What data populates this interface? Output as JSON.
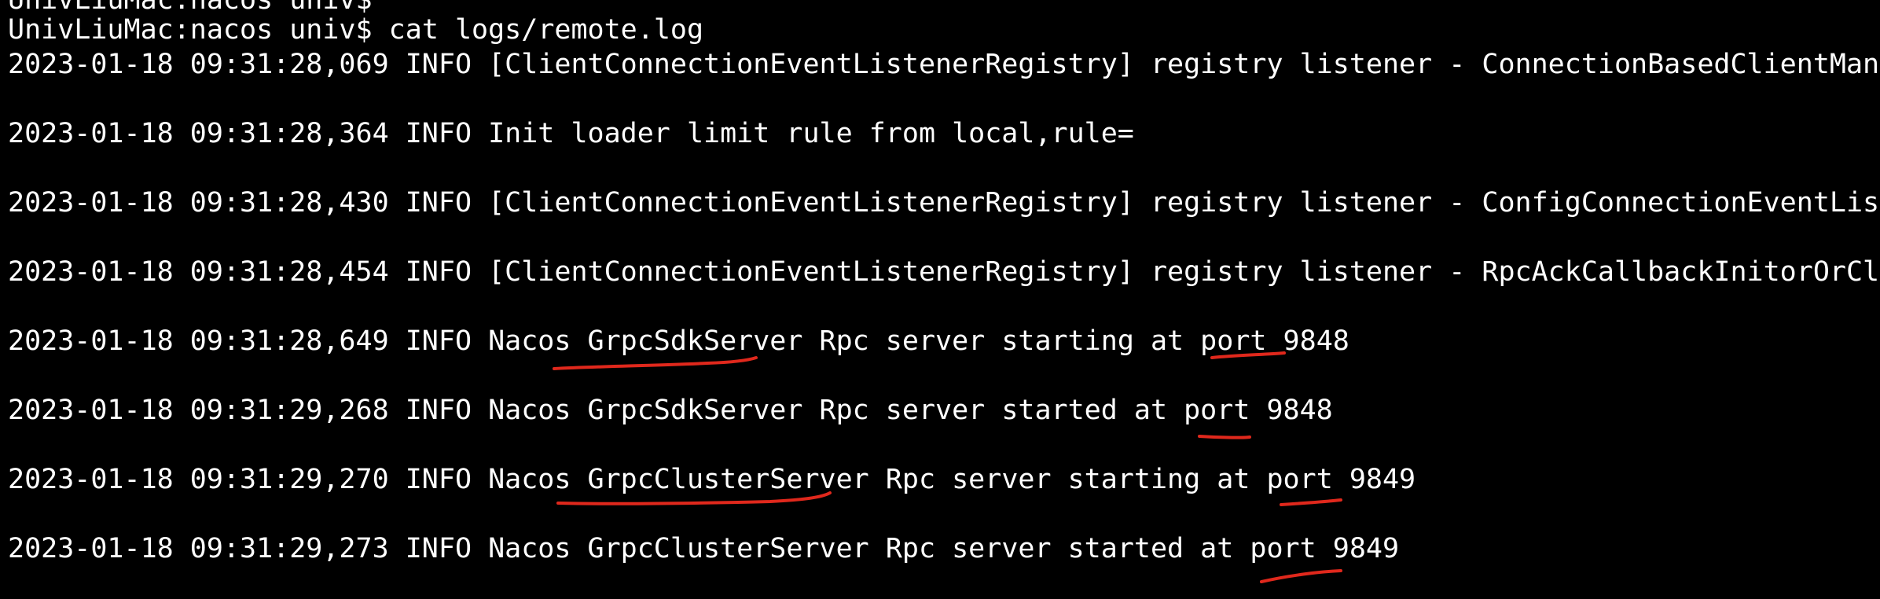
{
  "terminal": {
    "background": "#000000",
    "foreground": "#ffffff",
    "annotation_color": "#e0281c",
    "prev_prompt": "UnivLiuMac:nacos univ$",
    "prompt": "UnivLiuMac:nacos univ$",
    "command": "cat logs/remote.log",
    "log": [
      {
        "prefix": "2023-01-18 09:31:28,069 INFO [ClientConnectionEventListenerRegistry] registry listener - ConnectionBasedClientManager"
      },
      {
        "prefix": "2023-01-18 09:31:28,364 INFO Init loader limit rule from local,rule="
      },
      {
        "prefix": "2023-01-18 09:31:28,430 INFO [ClientConnectionEventListenerRegistry] registry listener - ConfigConnectionEventListener"
      },
      {
        "prefix": "2023-01-18 09:31:28,454 INFO [ClientConnectionEventListenerRegistry] registry listener - RpcAckCallbackInitorOrCleaner"
      },
      {
        "prefix": "2023-01-18 09:31:28,649 INFO Nacos ",
        "server": "GrpcSdkServer",
        "middle": " Rpc server starting at port ",
        "port": "9848"
      },
      {
        "prefix": "2023-01-18 09:31:29,268 INFO Nacos ",
        "server": "GrpcSdkServer",
        "middle": " Rpc server started at port ",
        "port": "9848"
      },
      {
        "prefix": "2023-01-18 09:31:29,270 INFO Nacos ",
        "server": "GrpcClusterServer",
        "middle": " Rpc server starting at port ",
        "port": "9849"
      },
      {
        "prefix": "2023-01-18 09:31:29,273 INFO Nacos ",
        "server": "GrpcClusterServer",
        "middle": " Rpc server started at port ",
        "port": "9849"
      }
    ]
  }
}
